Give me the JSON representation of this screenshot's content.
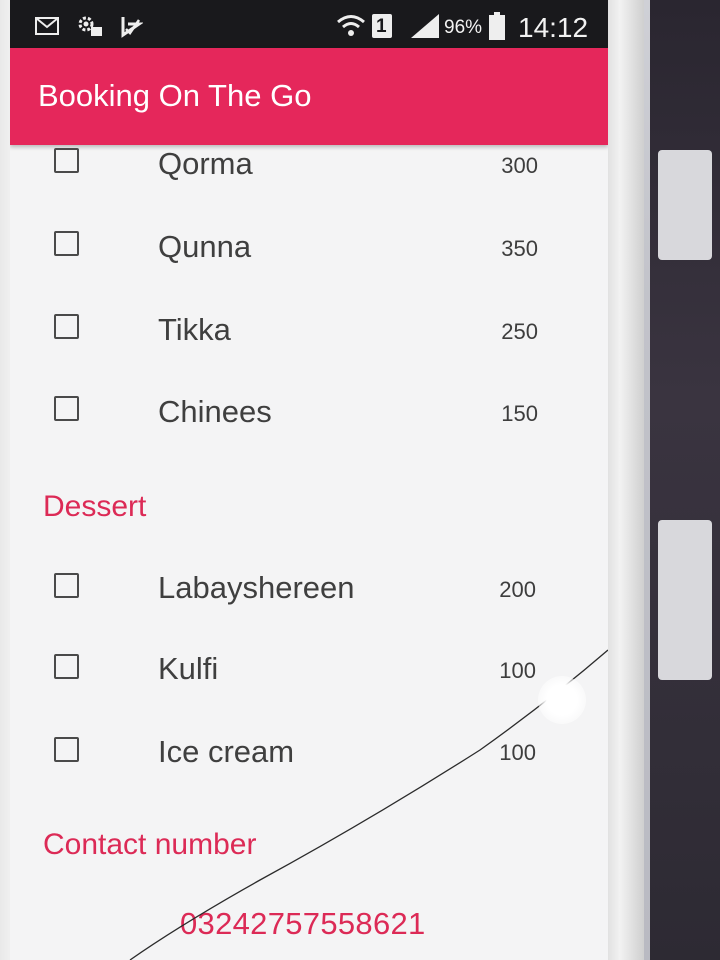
{
  "status_bar": {
    "left_icons": [
      "mail-icon",
      "settings-notification-icon",
      "download-check-icon"
    ],
    "right_icons": [
      "wifi-icon",
      "sim-icon",
      "signal-icon",
      "battery-icon"
    ],
    "sim_label": "1",
    "battery_percent": "96%",
    "time": "14:12"
  },
  "app_bar": {
    "title": "Booking On The Go",
    "color": "#e5275b"
  },
  "main_items": [
    {
      "name": "Qorma",
      "price": "300",
      "checked": false
    },
    {
      "name": "Qunna",
      "price": "350",
      "checked": false
    },
    {
      "name": "Tikka",
      "price": "250",
      "checked": false
    },
    {
      "name": "Chinees",
      "price": "150",
      "checked": false
    }
  ],
  "dessert": {
    "title": "Dessert",
    "items": [
      {
        "name": "Labayshereen",
        "price": "200",
        "checked": false
      },
      {
        "name": "Kulfi",
        "price": "100",
        "checked": false
      },
      {
        "name": "Ice cream",
        "price": "100",
        "checked": false
      }
    ]
  },
  "contact": {
    "title": "Contact number",
    "number": "03242757558621"
  },
  "colors": {
    "accent": "#dc2a56",
    "status_bar": "#19191c",
    "background": "#f4f4f5"
  }
}
